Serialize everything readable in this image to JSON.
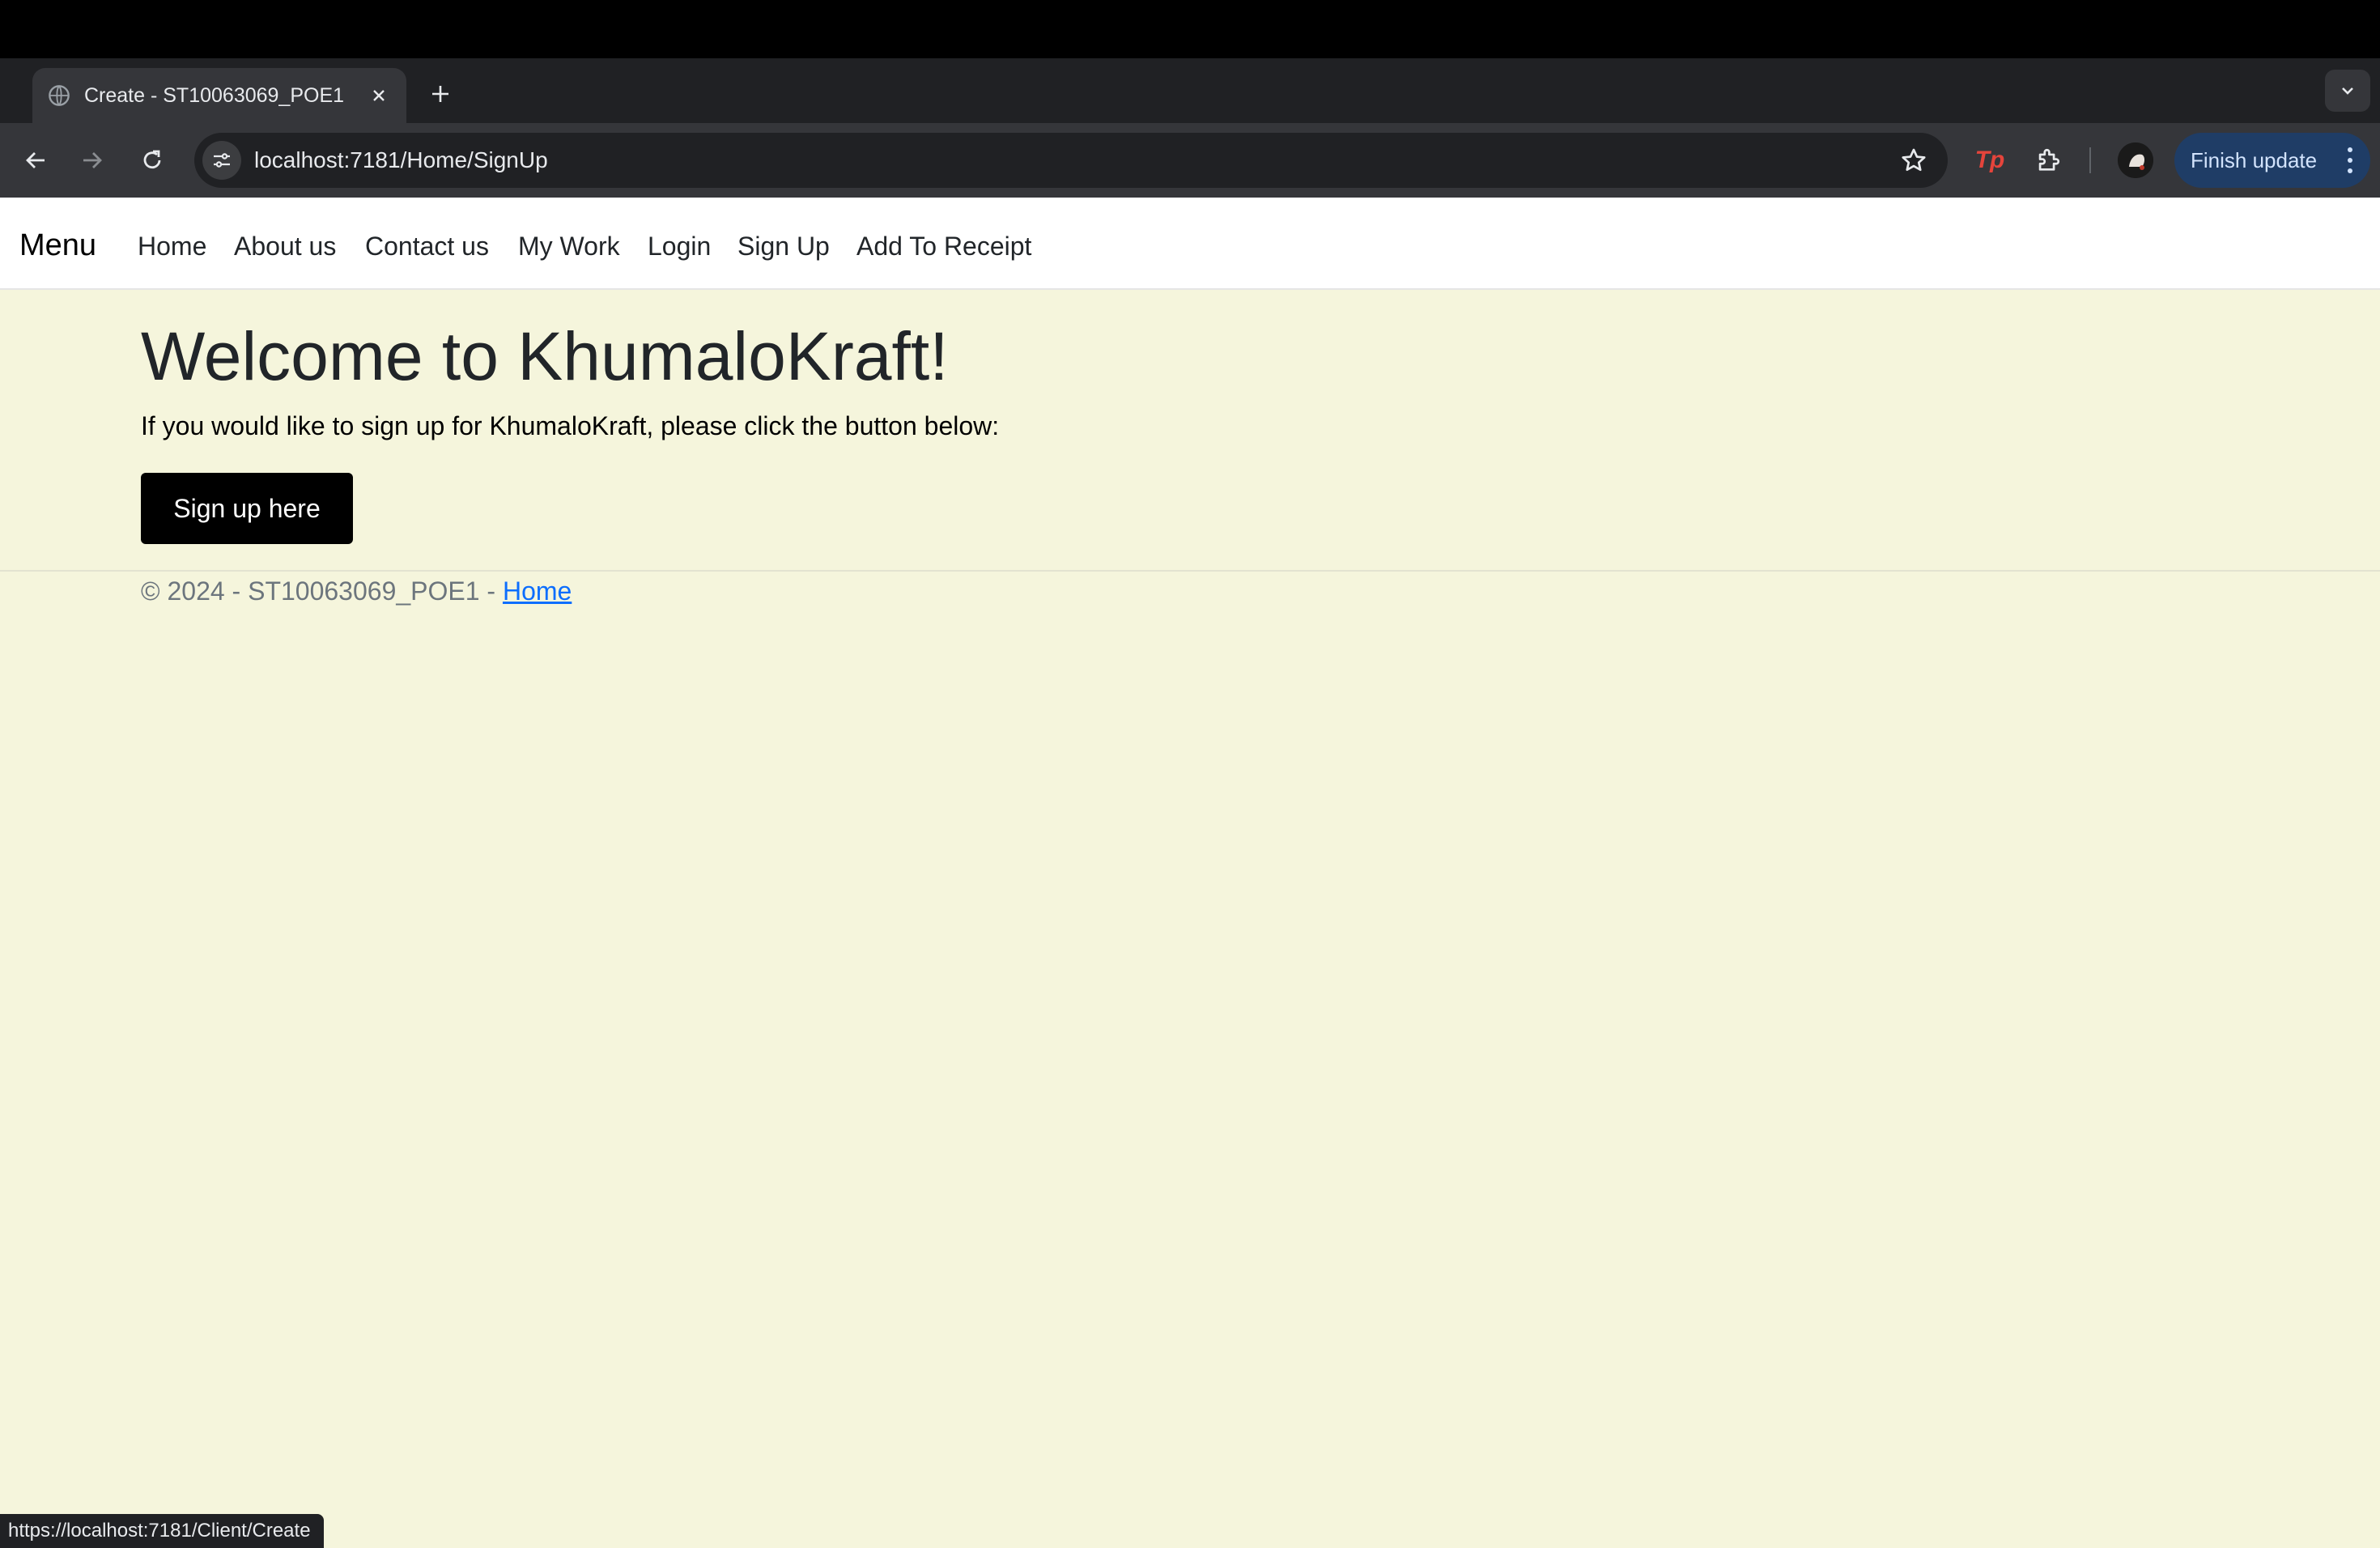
{
  "browser": {
    "tab_title": "Create - ST10063069_POE1",
    "url": "localhost:7181/Home/SignUp",
    "finish_update_label": "Finish update",
    "extension_label": "Tp",
    "status_url": "https://localhost:7181/Client/Create",
    "accent_color": "#1f3d66"
  },
  "nav": {
    "brand": "Menu",
    "links": [
      "Home",
      "About us",
      "Contact us",
      "My Work",
      "Login",
      "Sign Up",
      "Add To Receipt"
    ]
  },
  "main": {
    "title": "Welcome to KhumaloKraft!",
    "intro": "If you would like to sign up for KhumaloKraft, please click the button below:",
    "button_label": "Sign up here",
    "background_color": "#f5f5dc"
  },
  "footer": {
    "text": "© 2024 - ST10063069_POE1 - ",
    "link_label": "Home"
  }
}
